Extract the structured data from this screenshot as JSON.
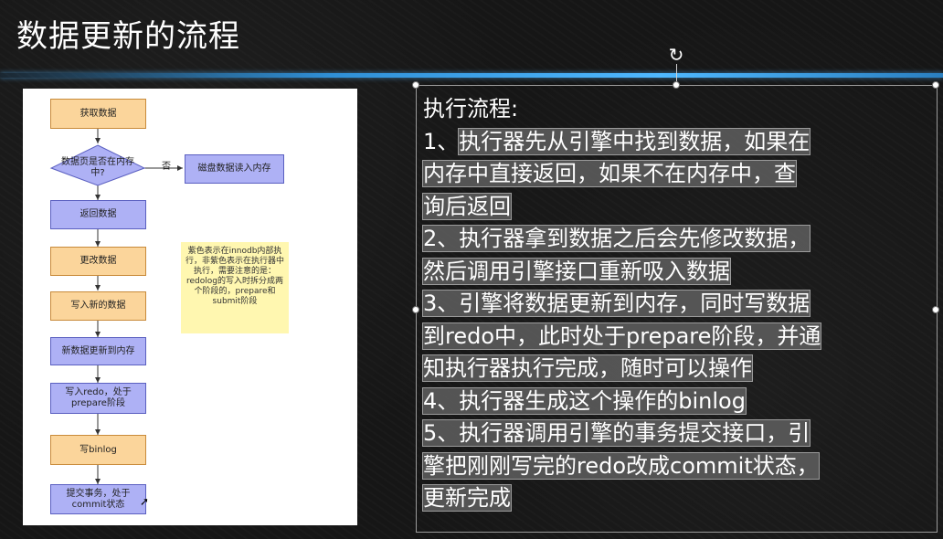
{
  "slide": {
    "title": "数据更新的流程"
  },
  "diagram": {
    "nodes": {
      "fetch": "获取数据",
      "decision": "数据页是否在内存中?",
      "no_label": "否",
      "disk": "磁盘数据读入内存",
      "return": "返回数据",
      "update": "更改数据",
      "write_new": "写入新的数据",
      "to_memory": "新数据更新到内存",
      "write_redo": "写入redo，处于prepare阶段",
      "write_binlog": "写binlog",
      "commit": "提交事务，处于commit状态"
    },
    "note": "紫色表示在innodb内部执行，非紫色表示在执行器中执行，需要注意的是：redolog的写入时拆分成两个阶段的，prepare和submit阶段"
  },
  "text": {
    "heading": "执行流程:",
    "lines": [
      {
        "plain": "1、",
        "hl": "执行器先从引擎中找到数据，如果在"
      },
      {
        "plain": "",
        "hl": "内存中直接返回，如果不在内存中，查"
      },
      {
        "plain": "",
        "hl": "询后返回"
      },
      {
        "plain": "",
        "hl": "2、执行器拿到数据之后会先修改数据，"
      },
      {
        "plain": "",
        "hl": "然后调用引擎接口重新吸入数据"
      },
      {
        "plain": "",
        "hl": "3、引擎将数据更新到内存，同时写数据"
      },
      {
        "plain": "",
        "hl": "到redo中，此时处于prepare阶段，并通"
      },
      {
        "plain": "",
        "hl": "知执行器执行完成，随时可以操作"
      },
      {
        "plain": "",
        "hl": "4、执行器生成这个操作的binlog"
      },
      {
        "plain": "",
        "hl": "5、执行器调用引擎的事务提交接口，引"
      },
      {
        "plain": "",
        "hl": "擎把刚刚写完的redo改成commit状态，"
      },
      {
        "plain": "",
        "hl": "更新完成"
      }
    ]
  },
  "colors": {
    "background": "#161616",
    "divider": "#4fb8ff",
    "orange_node": "#fbd59b",
    "purple_node": "#aeb1f5",
    "note": "#fff7b0",
    "highlight": "#5f5f5f"
  },
  "icons": {
    "rotate": "rotate-icon",
    "cursor": "mouse-cursor-icon"
  }
}
